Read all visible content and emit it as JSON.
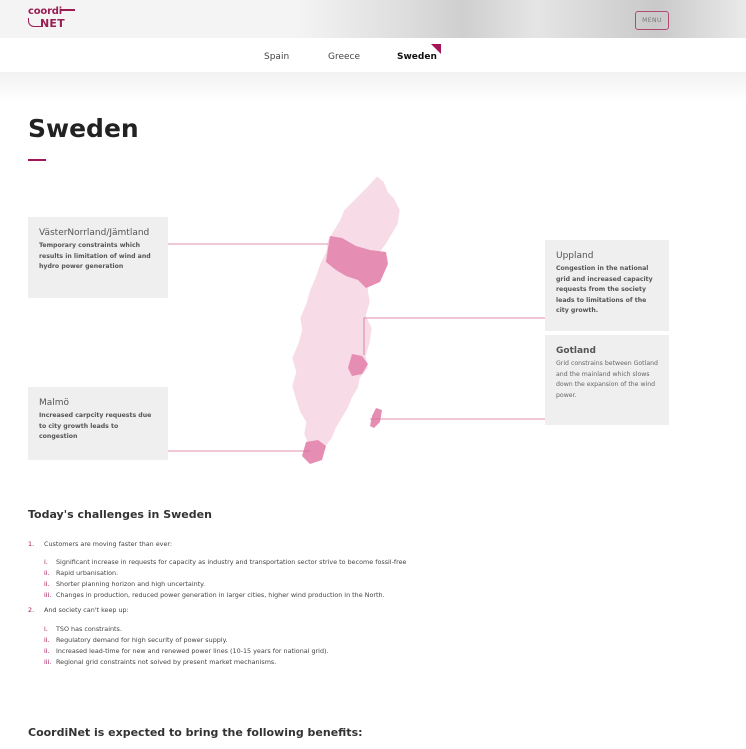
{
  "header": {
    "logo_top": "coordi",
    "logo_bottom": "NET",
    "menu_label": "MENU"
  },
  "tabs": [
    {
      "label": "Spain",
      "active": false
    },
    {
      "label": "Greece",
      "active": false
    },
    {
      "label": "Sweden",
      "active": true
    }
  ],
  "page": {
    "title": "Sweden"
  },
  "regions": {
    "vasternorrland": {
      "title": "VästerNorrland/Jämtland",
      "desc": "Temporary constraints which results in limitation of wind and hydro power generation"
    },
    "uppland": {
      "title": "Uppland",
      "desc": "Congestion in the national grid and increased capacity requests from the society leads to limitations of the city growth."
    },
    "gotland": {
      "title": "Gotland",
      "desc": "Grid constrains between Gotland and the mainland which slows down the expansion of the wind power."
    },
    "malmo": {
      "title": "Malmö",
      "desc": "Increased carpcity requests due to city growth leads to congestion"
    }
  },
  "colors": {
    "accent": "#a3145a",
    "map_light": "#f7dbe6",
    "map_highlight": "#e68db3"
  },
  "challenges": {
    "heading": "Today's challenges in Sweden",
    "items": [
      {
        "num": "1.",
        "text": "Customers are moving faster than ever:",
        "sub": [
          {
            "num": "i.",
            "text": "Significant increase in requests for capacity as industry and transportation sector strive to become fossil-free"
          },
          {
            "num": "ii.",
            "text": "Rapid urbanisation."
          },
          {
            "num": "ii.",
            "text": "Shorter planning horizon and high uncertainty."
          },
          {
            "num": "iii.",
            "text": "Changes in production, reduced power generation in larger cities, higher wind production in the North."
          }
        ]
      },
      {
        "num": "2.",
        "text": "And society can't keep up:",
        "sub": [
          {
            "num": "i.",
            "text": "TSO has constraints."
          },
          {
            "num": "ii.",
            "text": "Regulatory demand for high security of power supply."
          },
          {
            "num": "ii.",
            "text": "Increased lead-time for new and renewed power lines (10-15 years for national grid)."
          },
          {
            "num": "iii.",
            "text": "Regional grid constraints not solved by present market mechanisms."
          }
        ]
      }
    ]
  },
  "benefits": {
    "heading": "CoordiNet is expected to bring the following benefits:"
  }
}
